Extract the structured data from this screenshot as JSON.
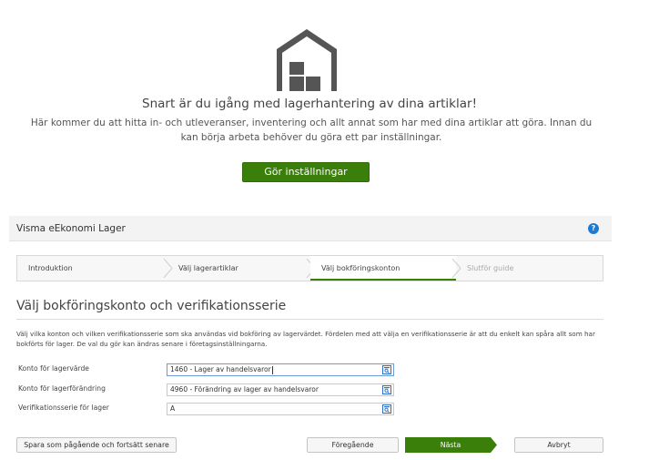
{
  "hero": {
    "title": "Snart är du igång med lagerhantering av dina artiklar!",
    "text": "Här kommer du att hitta in- och utleveranser, inventering och allt annat som har med dina artiklar att göra. Innan du kan börja arbeta behöver du göra ett par inställningar.",
    "cta_label": "Gör inställningar"
  },
  "panel": {
    "title": "Visma eEkonomi Lager",
    "help": "?"
  },
  "wizard": {
    "steps": [
      {
        "label": "Introduktion"
      },
      {
        "label": "Välj lagerartiklar"
      },
      {
        "label": "Välj bokföringskonton"
      },
      {
        "label": "Slutför guide"
      }
    ],
    "active_step": "Välj bokföringskonton"
  },
  "section": {
    "title": "Välj bokföringskonto och verifikationsserie",
    "description": "Välj vilka konton och vilken verifikationsserie som ska användas vid bokföring av lagervärdet. Fördelen med att välja en verifikationsserie är att du enkelt kan spåra allt som har bokförts för lager. De val du gör kan ändras senare i företagsinställningarna."
  },
  "form": {
    "fields": [
      {
        "label": "Konto för lagervärde",
        "value": "1460 - Lager av handelsvaror"
      },
      {
        "label": "Konto för lagerförändring",
        "value": "4960 - Förändring av lager av handelsvaror"
      },
      {
        "label": "Verifikationsserie för lager",
        "value": "A"
      }
    ]
  },
  "footer": {
    "save_label": "Spara som pågående och fortsätt senare",
    "prev_label": "Föregående",
    "next_label": "Nästa",
    "cancel_label": "Avbryt"
  },
  "colors": {
    "accent_green": "#3a7f0a",
    "help_blue": "#1e7ad1",
    "lookup_blue": "#2b6fc4"
  }
}
